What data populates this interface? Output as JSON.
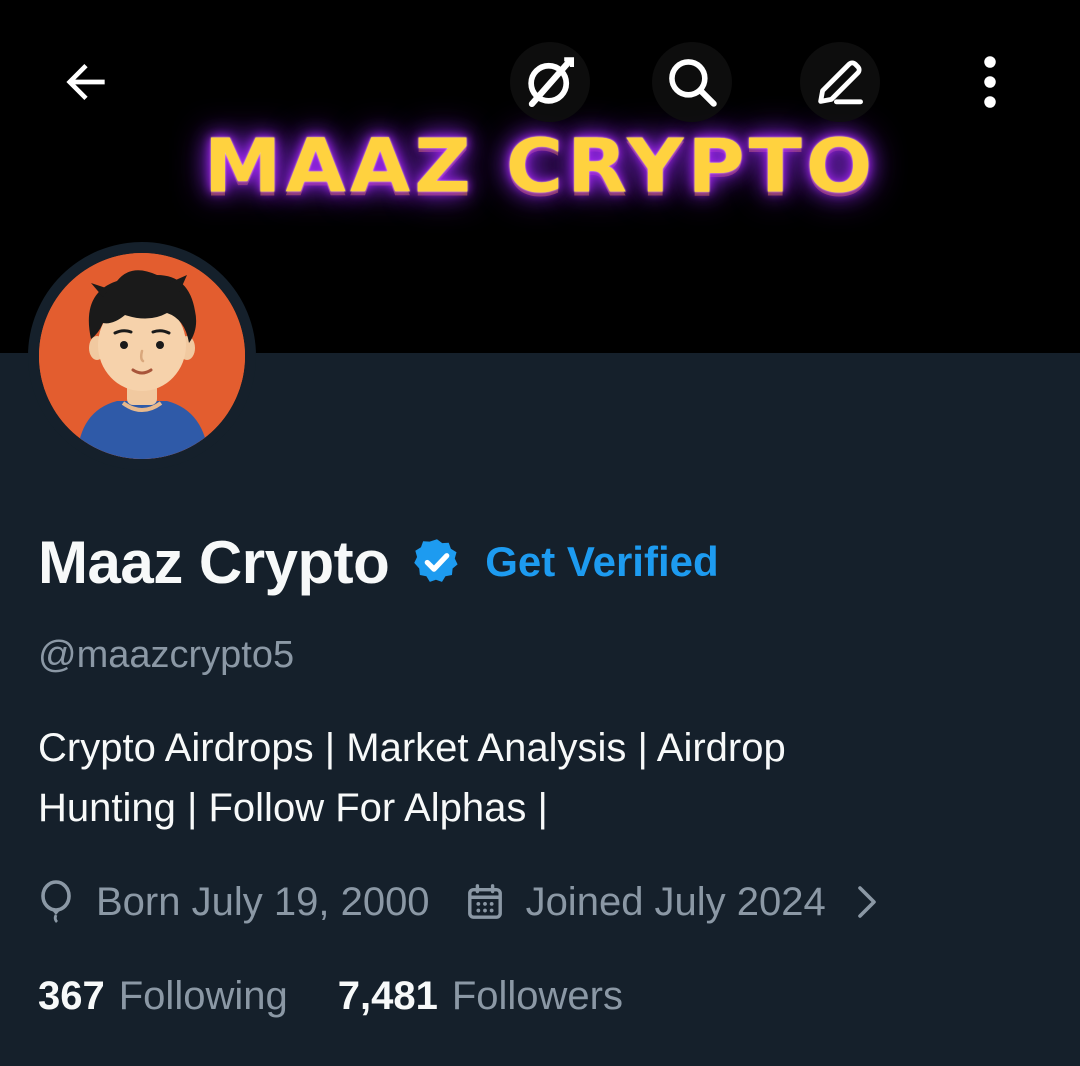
{
  "banner": {
    "text": "MAAZ CRYPTO"
  },
  "topbar": {
    "back_icon": "arrow-left-icon",
    "grok_icon": "grok-icon",
    "search_icon": "search-icon",
    "edit_icon": "pencil-icon",
    "more_icon": "vertical-dots-icon"
  },
  "profile": {
    "display_name": "Maaz Crypto",
    "verified": true,
    "get_verified_label": "Get Verified",
    "handle": "@maazcrypto5",
    "bio_line1": "Crypto Airdrops | Market Analysis | Airdrop",
    "bio_line2": "Hunting | Follow For Alphas |",
    "birthday": "Born July 19, 2000",
    "joined": "Joined July 2024",
    "following_count": "367",
    "following_label": "Following",
    "followers_count": "7,481",
    "followers_label": "Followers"
  },
  "colors": {
    "background": "#15202b",
    "primary_text": "#f7f9f9",
    "secondary_text": "#8b98a5",
    "accent_blue": "#1d9bf0",
    "banner_text": "#ffd23f",
    "banner_glow": "#8a2be2",
    "avatar_bg": "#e35d2f"
  }
}
